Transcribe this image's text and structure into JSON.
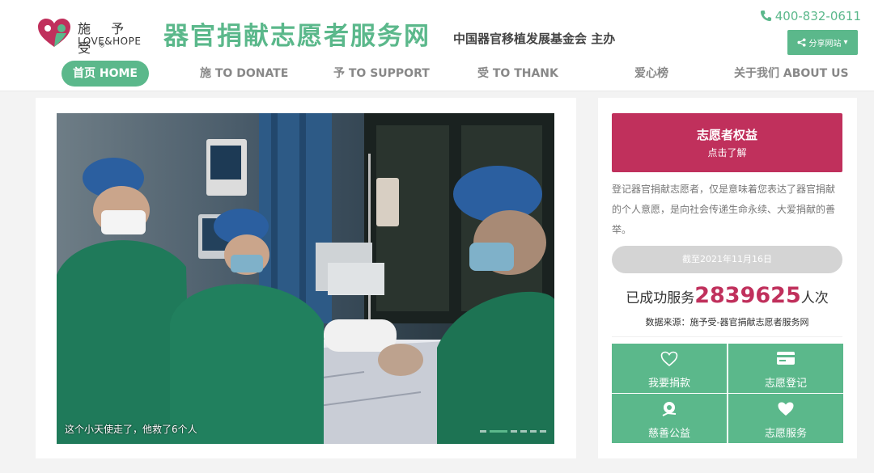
{
  "header": {
    "logo_cn": "施 予 受",
    "logo_en": "LOVE&HOPE",
    "title": "器官捐献志愿者服务网",
    "sponsor": "中国器官移植发展基金会  主办",
    "phone": "400-832-0611",
    "share_label": "分享网站"
  },
  "nav": {
    "items": [
      {
        "label": "首页 HOME",
        "active": true
      },
      {
        "label": "施 TO DONATE"
      },
      {
        "label": "予 TO SUPPORT"
      },
      {
        "label": "受 TO THANK"
      },
      {
        "label": "爱心榜"
      },
      {
        "label": "关于我们 ABOUT US"
      }
    ]
  },
  "carousel": {
    "caption": "这个小天使走了，他救了6个人",
    "slides": 6,
    "active_slide": 2
  },
  "sidebar": {
    "rights_title": "志愿者权益",
    "rights_sub": "点击了解",
    "description": "登记器官捐献志愿者，仅是意味着您表达了器官捐献的个人意愿，是向社会传递生命永续、大爱捐献的善举。",
    "date": "截至2021年11月16日",
    "count_prefix": "已成功服务",
    "count": "2839625",
    "count_suffix": "人次",
    "source": "数据来源：施予受-器官捐献志愿者服务网",
    "tiles": [
      {
        "label": "我要捐款",
        "icon": "heart-outline-icon"
      },
      {
        "label": "志愿登记",
        "icon": "card-icon"
      },
      {
        "label": "慈善公益",
        "icon": "charity-icon"
      },
      {
        "label": "志愿服务",
        "icon": "heart-icon"
      }
    ]
  },
  "colors": {
    "brand_green": "#5bb88b",
    "brand_red": "#c0305c"
  }
}
